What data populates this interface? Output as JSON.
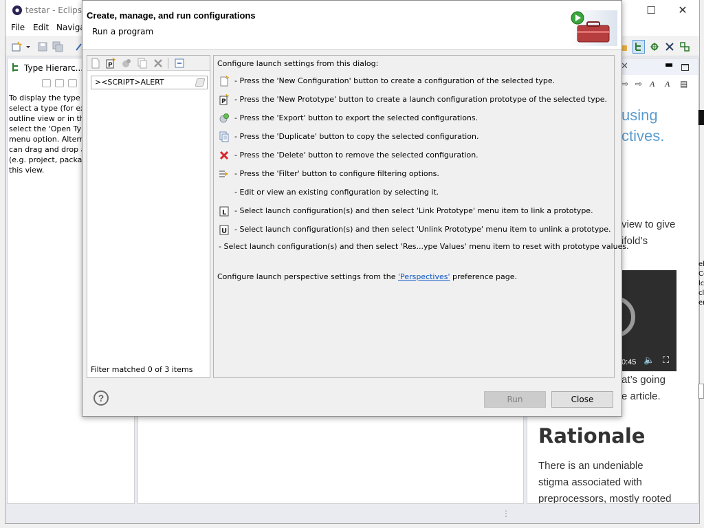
{
  "eclipse": {
    "title": "testar - Eclipse I",
    "menus": [
      "File",
      "Edit",
      "Navigat"
    ],
    "type_hierarchy": {
      "tab_label": "Type Hierarc...",
      "text": "To display the type h\nselect a type (for exa\noutline view or in the\nselect the 'Open Typ\nmenu option. Altern\ncan drag and drop a\n(e.g. project, packag\nthis view."
    },
    "browser": {
      "heading_line1": "using",
      "heading_line2": "ctives.",
      "para1": "view to give\nifold’s",
      "video_time": "0:45",
      "para2": "at’s going\ne article.",
      "rationale": "Rationale",
      "para3": "There is an undeniable\nstigma associated with\npreprocessors, mostly rooted"
    },
    "right_edge_text": "el\nCo\nlc\ncl\ner"
  },
  "dialog": {
    "title": "Create, manage, and run configurations",
    "subtitle": "Run a program",
    "filter": {
      "value": "><SCRIPT>ALERT",
      "status": "Filter matched 0 of 3 items"
    },
    "toolbar_icons": [
      "new-config-icon",
      "new-prototype-icon",
      "export-icon",
      "duplicate-icon",
      "delete-icon",
      "collapse-all-icon"
    ],
    "info": {
      "intro": "Configure launch settings from this dialog:",
      "rows": [
        {
          "icon": "new-config-icon",
          "text": "- Press the 'New Configuration' button to create a configuration of the selected type."
        },
        {
          "icon": "new-prototype-icon",
          "text": "- Press the 'New Prototype' button to create a launch configuration prototype of the selected type."
        },
        {
          "icon": "export-icon",
          "text": "- Press the 'Export' button to export the selected configurations."
        },
        {
          "icon": "duplicate-icon",
          "text": "- Press the 'Duplicate' button to copy the selected configuration."
        },
        {
          "icon": "delete-icon",
          "text": "- Press the 'Delete' button to remove the selected configuration."
        },
        {
          "icon": "filter-icon",
          "text": "- Press the 'Filter' button to configure filtering options."
        },
        {
          "icon": "",
          "text": "- Edit or view an existing configuration by selecting it."
        },
        {
          "icon": "link-prototype-icon",
          "text": "- Select launch configuration(s) and then select 'Link Prototype' menu item to link a prototype."
        },
        {
          "icon": "unlink-prototype-icon",
          "text": "- Select launch configuration(s) and then select 'Unlink Prototype' menu item to unlink a prototype."
        }
      ],
      "reset_row": "- Select launch configuration(s) and then select 'Res...ype Values' menu item to reset with prototype values.",
      "perspective_prefix": "Configure launch perspective settings from the ",
      "perspective_link": "'Perspectives'",
      "perspective_suffix": " preference page."
    },
    "buttons": {
      "help": "?",
      "run": "Run",
      "close": "Close"
    }
  },
  "colors": {
    "link": "#0b56c7",
    "heading_blue": "#5b9ccf",
    "delete_red": "#d9262a"
  }
}
